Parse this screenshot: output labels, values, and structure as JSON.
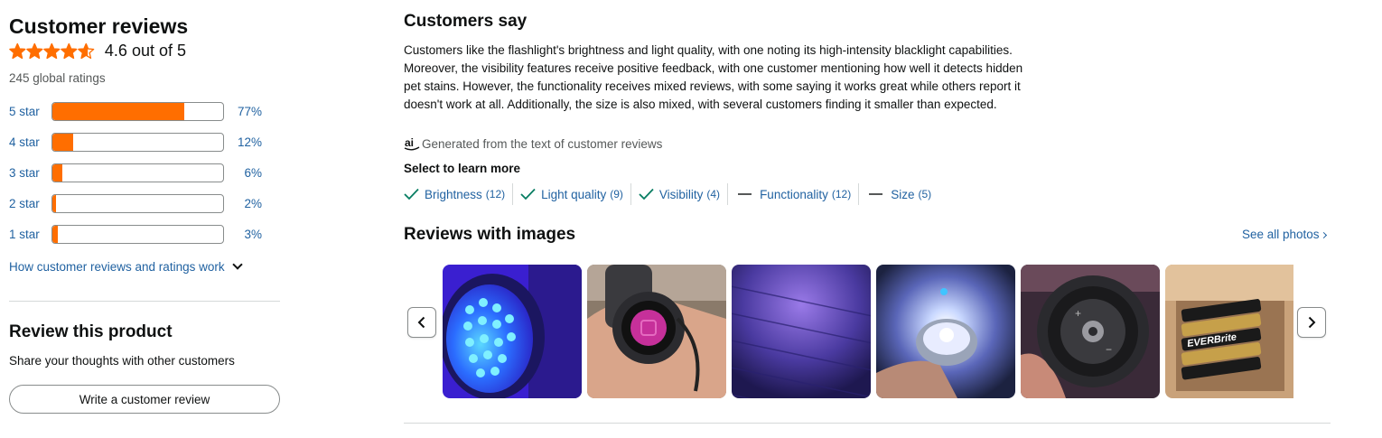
{
  "customer_reviews": {
    "title": "Customer reviews",
    "rating_text": "4.6 out of 5",
    "rating_value": 4.6,
    "global_ratings": "245 global ratings",
    "histogram": [
      {
        "label": "5 star",
        "percent_text": "77%",
        "percent": 77
      },
      {
        "label": "4 star",
        "percent_text": "12%",
        "percent": 12
      },
      {
        "label": "3 star",
        "percent_text": "6%",
        "percent": 6
      },
      {
        "label": "2 star",
        "percent_text": "2%",
        "percent": 2
      },
      {
        "label": "1 star",
        "percent_text": "3%",
        "percent": 3
      }
    ],
    "how_link": "How customer reviews and ratings work",
    "star_color": "#FF6E00"
  },
  "review_product": {
    "title": "Review this product",
    "subtitle": "Share your thoughts with other customers",
    "button_label": "Write a customer review"
  },
  "customers_say": {
    "title": "Customers say",
    "summary": "Customers like the flashlight's brightness and light quality, with one noting its high-intensity blacklight capabilities. Moreover, the visibility features receive positive feedback, with one customer mentioning how well it detects hidden pet stains. However, the functionality receives mixed reviews, with some saying it works great while others report it doesn't work at all. Additionally, the size is also mixed, with several customers finding it smaller than expected.",
    "ai_note": "Generated from the text of customer reviews",
    "select_label": "Select to learn more",
    "aspects": [
      {
        "name": "Brightness",
        "count": "(12)",
        "sentiment": "positive",
        "icon": "check-icon"
      },
      {
        "name": "Light quality",
        "count": "(9)",
        "sentiment": "positive",
        "icon": "check-icon"
      },
      {
        "name": "Visibility",
        "count": "(4)",
        "sentiment": "positive",
        "icon": "check-icon"
      },
      {
        "name": "Functionality",
        "count": "(12)",
        "sentiment": "mixed",
        "icon": "dash-icon"
      },
      {
        "name": "Size",
        "count": "(5)",
        "sentiment": "mixed",
        "icon": "dash-icon"
      }
    ]
  },
  "reviews_with_images": {
    "title": "Reviews with images",
    "see_all": "See all photos",
    "images": [
      {
        "name": "uv-flashlight-led-closeup"
      },
      {
        "name": "flashlight-pink-button-in-hand"
      },
      {
        "name": "uv-light-on-wood-floor"
      },
      {
        "name": "flashlight-beam-in-hand"
      },
      {
        "name": "flashlight-battery-cap-closeup"
      },
      {
        "name": "everbrite-batteries-in-box"
      }
    ],
    "everbrite_label": "EVERBrite"
  }
}
